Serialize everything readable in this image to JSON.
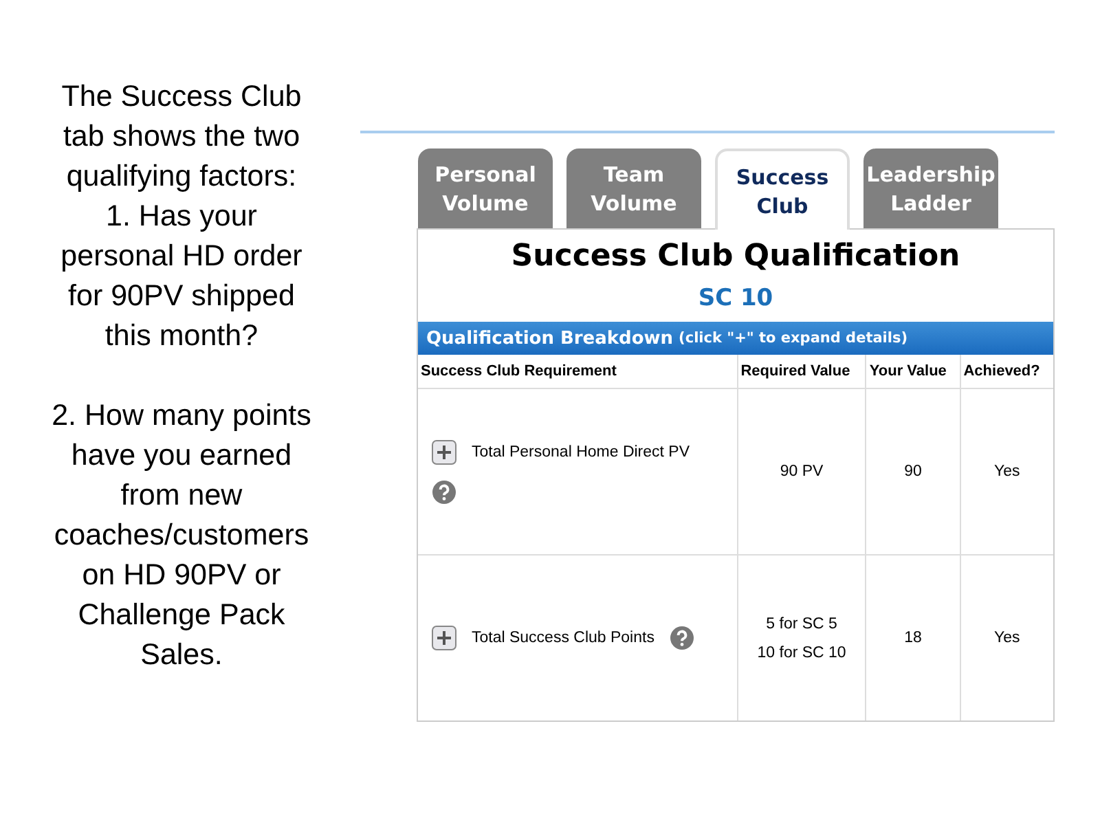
{
  "notes": [
    [
      "The Success Club",
      "tab shows the two",
      "qualifying factors:",
      "1.  Has your",
      "personal HD order",
      "for 90PV shipped",
      "this month?"
    ],
    [
      "2.  How many points",
      "have you earned",
      "from new",
      "coaches/customers",
      "on HD 90PV or",
      "Challenge Pack",
      "Sales."
    ]
  ],
  "tabs": [
    {
      "label": "Personal Volume",
      "selected": false
    },
    {
      "label": "Team Volume",
      "selected": false
    },
    {
      "label": "Success Club",
      "selected": true
    },
    {
      "label": "Leadership Ladder",
      "selected": false
    }
  ],
  "panel": {
    "title": "Success Club Qualification",
    "level_name": "SC 10",
    "breakdown": {
      "title": "Qualification Breakdown",
      "hint": "(click \"+\" to expand details)"
    },
    "table": {
      "columns": [
        "Success Club Requirement",
        "Required Value",
        "Your Value",
        "Achieved?"
      ],
      "rows": [
        {
          "requirement": "Total Personal Home Direct PV",
          "required": [
            "90 PV"
          ],
          "value": "90",
          "achieved": "Yes"
        },
        {
          "requirement": "Total Success Club Points",
          "required": [
            "5 for SC 5",
            "10 for SC 10"
          ],
          "value": "18",
          "achieved": "Yes"
        }
      ]
    }
  }
}
